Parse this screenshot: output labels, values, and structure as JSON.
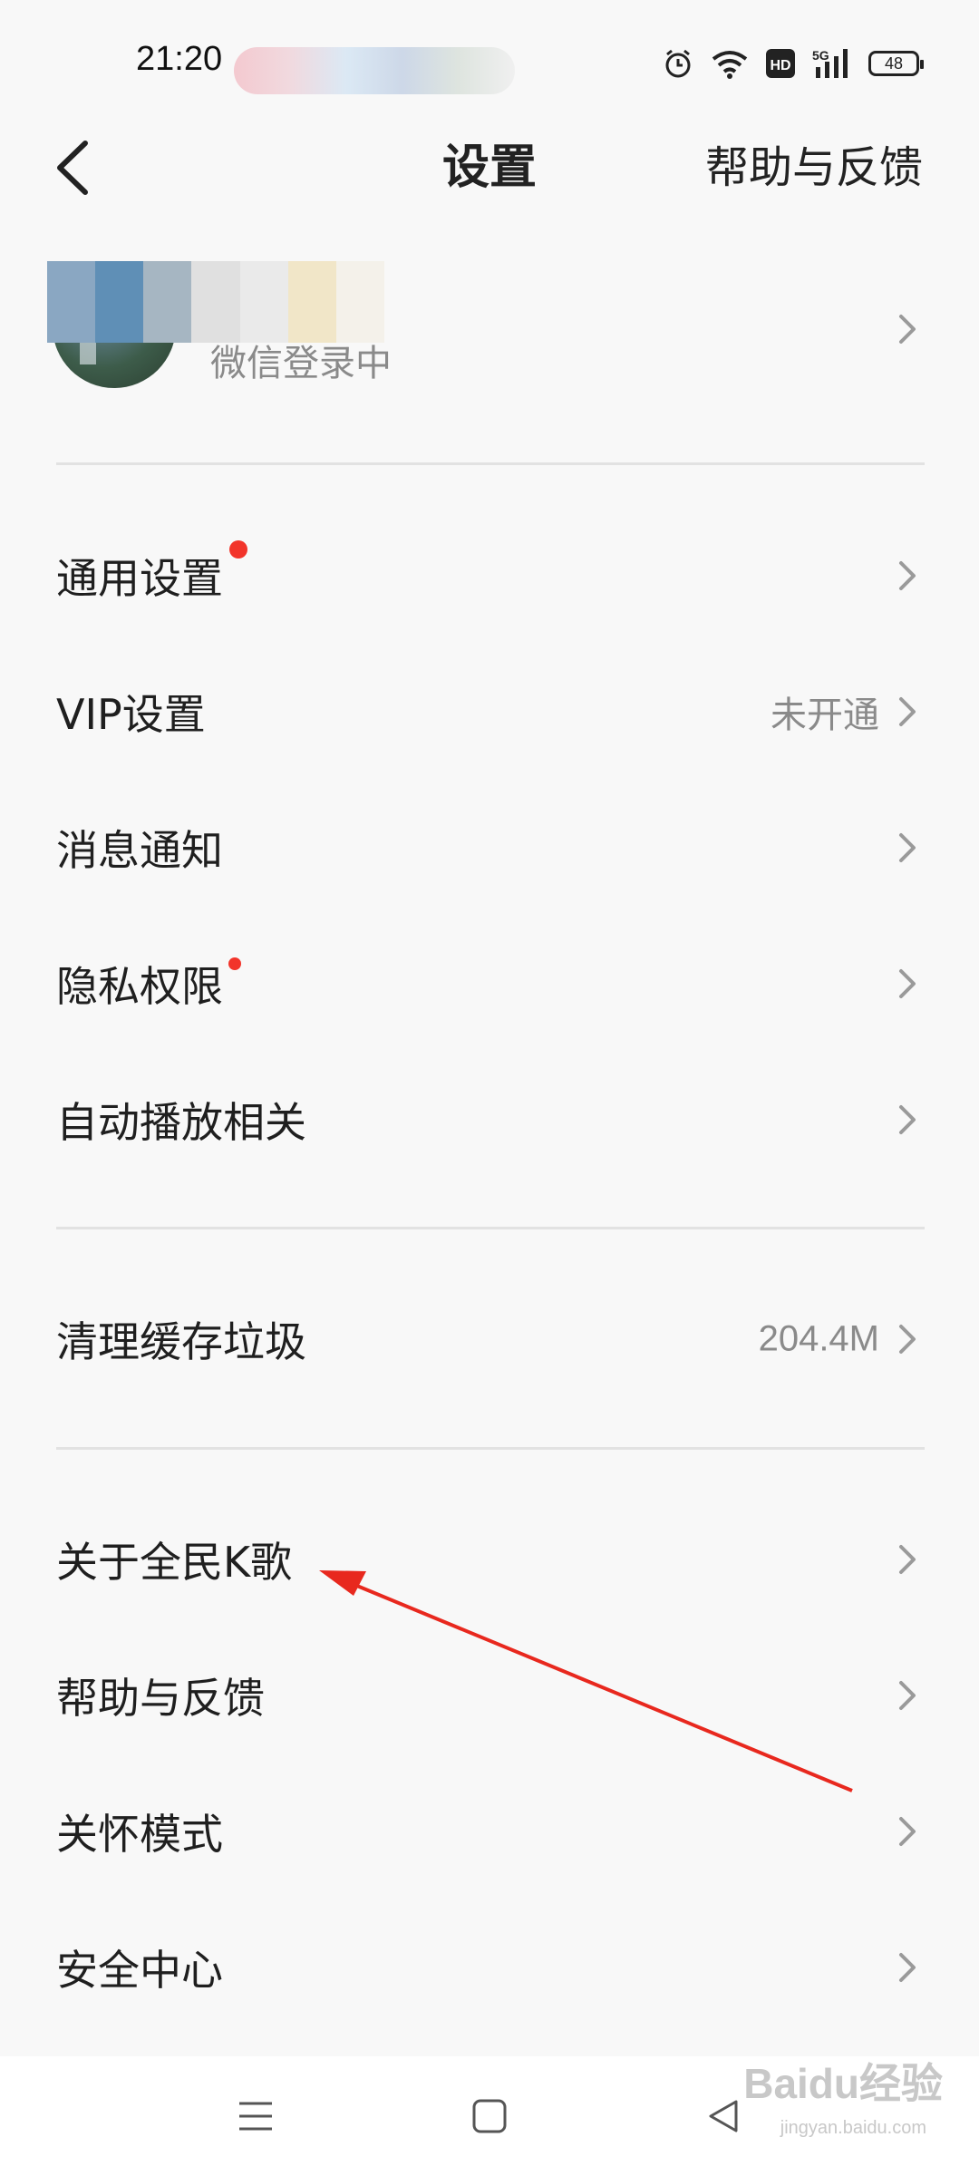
{
  "status_bar": {
    "time": "21:20",
    "battery": "48",
    "icons": [
      "alarm-icon",
      "wifi-icon",
      "hd-icon",
      "signal-5g-icon",
      "battery-icon"
    ]
  },
  "header": {
    "title": "设置",
    "right_link": "帮助与反馈",
    "back_icon": "chevron-left-icon"
  },
  "profile": {
    "subtitle": "微信登录中",
    "chevron_icon": "chevron-right-icon"
  },
  "sections": [
    {
      "items": [
        {
          "label": "通用设置",
          "value": "",
          "badge": true
        },
        {
          "label": "VIP设置",
          "value": "未开通",
          "badge": false
        },
        {
          "label": "消息通知",
          "value": "",
          "badge": false
        },
        {
          "label": "隐私权限",
          "value": "",
          "badge": true
        },
        {
          "label": "自动播放相关",
          "value": "",
          "badge": false
        }
      ]
    },
    {
      "items": [
        {
          "label": "清理缓存垃圾",
          "value": "204.4M",
          "badge": false
        }
      ]
    },
    {
      "items": [
        {
          "label": "关于全民K歌",
          "value": "",
          "badge": false
        },
        {
          "label": "帮助与反馈",
          "value": "",
          "badge": false
        },
        {
          "label": "关怀模式",
          "value": "",
          "badge": false
        },
        {
          "label": "安全中心",
          "value": "",
          "badge": false
        }
      ]
    }
  ],
  "system_nav": {
    "icons": [
      "menu-icon",
      "home-icon",
      "back-triangle-icon"
    ]
  },
  "watermark": {
    "brand": "Baidu经验",
    "url": "jingyan.baidu.com"
  },
  "colors": {
    "background": "#f8f8f8",
    "badge_red": "#f2342a",
    "annotation_arrow": "#e8281e",
    "secondary_text": "#8a8a8a"
  }
}
